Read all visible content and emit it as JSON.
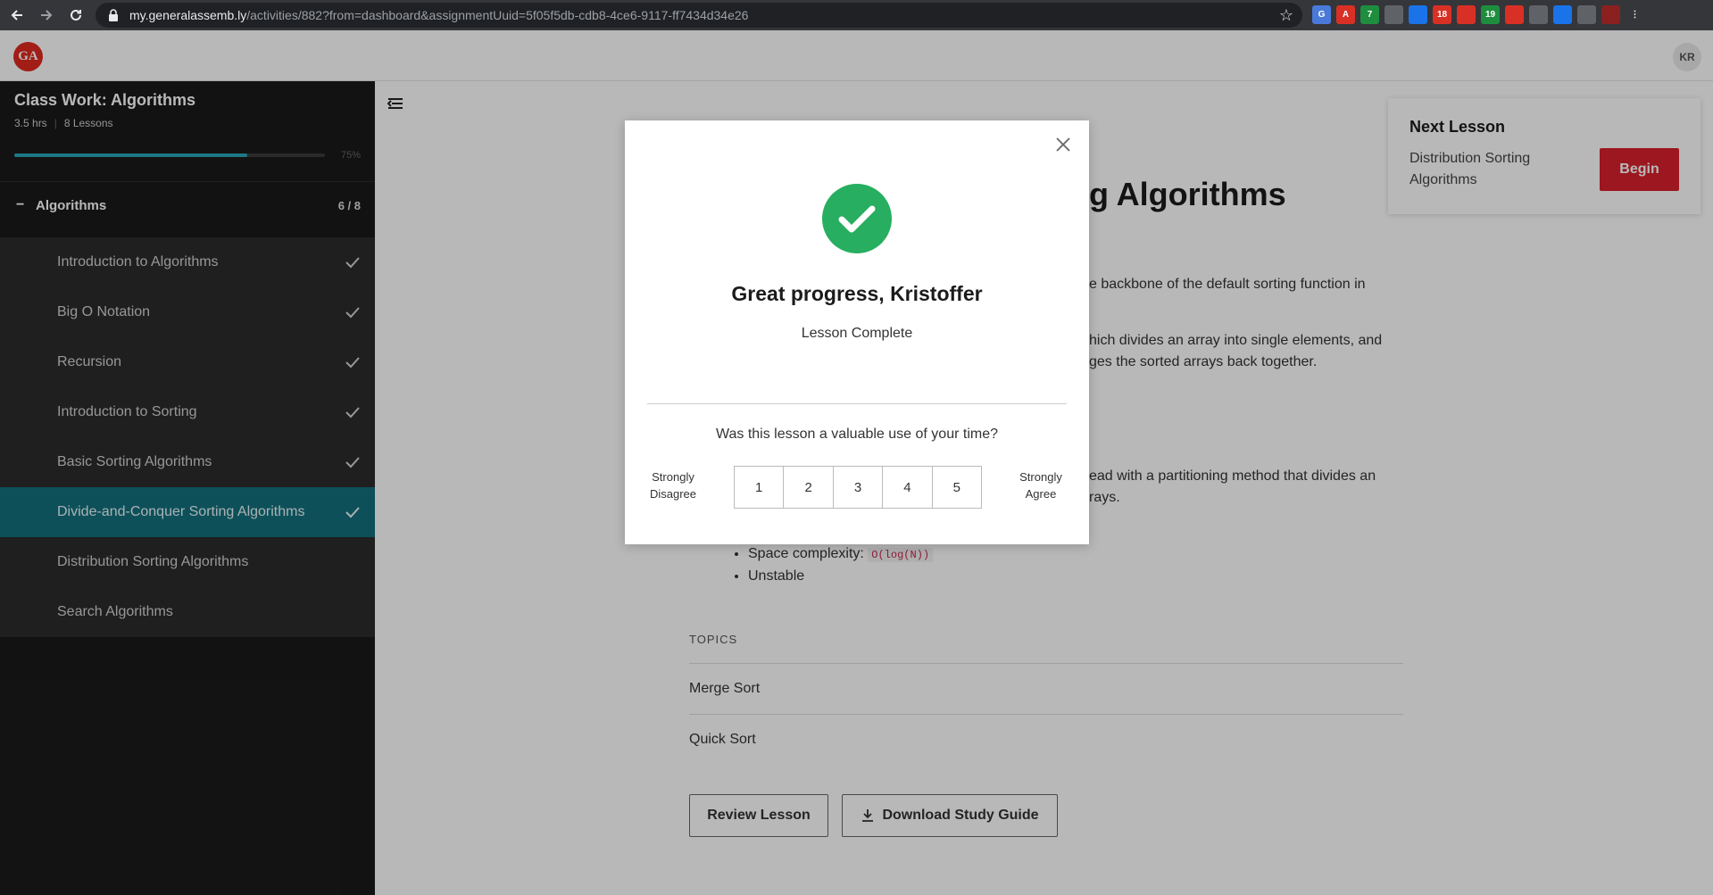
{
  "browser": {
    "url_host": "my.generalassemb.ly",
    "url_path": "/activities/882?from=dashboard&assignmentUuid=5f05f5db-cdb8-4ce6-9117-ff7434d34e26",
    "extensions": [
      {
        "name": "google-translate-icon",
        "color": "#4a7ad9",
        "text": "G"
      },
      {
        "name": "pdf-icon",
        "color": "#d93025",
        "text": "A"
      },
      {
        "name": "phone-extension-icon",
        "color": "#1e8e3e",
        "text": "7"
      },
      {
        "name": "pen-tool-icon",
        "color": "#5f6368",
        "text": ""
      },
      {
        "name": "send-extension-icon",
        "color": "#1a73e8",
        "text": ""
      },
      {
        "name": "adblock-icon",
        "color": "#d93025",
        "text": "18"
      },
      {
        "name": "stop-extension-icon",
        "color": "#d93025",
        "text": ""
      },
      {
        "name": "chat-extension-icon",
        "color": "#1e8e3e",
        "text": "19"
      },
      {
        "name": "lastpass-icon",
        "color": "#d93025",
        "text": ""
      },
      {
        "name": "layers-extension-icon",
        "color": "#5f6368",
        "text": ""
      },
      {
        "name": "react-devtools-icon",
        "color": "#1a73e8",
        "text": ""
      },
      {
        "name": "puzzle-icon",
        "color": "#5f6368",
        "text": ""
      },
      {
        "name": "profile-avatar-icon",
        "color": "#8a2020",
        "text": ""
      },
      {
        "name": "kebab-menu-icon",
        "color": "#35363a",
        "text": "⋮"
      }
    ]
  },
  "header": {
    "logo_text": "GA",
    "avatar_initials": "KR"
  },
  "sidebar": {
    "course_title": "Class Work: Algorithms",
    "duration": "3.5 hrs",
    "lessons_count": "8 Lessons",
    "progress_percent": 75,
    "progress_label": "75%",
    "section": {
      "toggle": "−",
      "name": "Algorithms",
      "count": "6 / 8"
    },
    "lessons": [
      {
        "label": "Introduction to Algorithms",
        "done": true,
        "active": false
      },
      {
        "label": "Big O Notation",
        "done": true,
        "active": false
      },
      {
        "label": "Recursion",
        "done": true,
        "active": false
      },
      {
        "label": "Introduction to Sorting",
        "done": true,
        "active": false
      },
      {
        "label": "Basic Sorting Algorithms",
        "done": true,
        "active": false
      },
      {
        "label": "Divide-and-Conquer Sorting Algorithms",
        "done": true,
        "active": true
      },
      {
        "label": "Distribution Sorting Algorithms",
        "done": false,
        "active": false
      },
      {
        "label": "Search Algorithms",
        "done": false,
        "active": false
      }
    ]
  },
  "main": {
    "title_visible": "g Algorithms",
    "para1": "e backbone of the default sorting function in",
    "para2_line1": "hich divides an array into single elements, and",
    "para2_line2": "ges the sorted arrays back together.",
    "para3_line1": "ead with a partitioning method that divides an",
    "para3_line2": "rays.",
    "bullet_space_label": "Space complexity:",
    "bullet_space_code": "O(log(N))",
    "bullet_unstable": "Unstable",
    "topics_label": "TOPICS",
    "topics": [
      "Merge Sort",
      "Quick Sort"
    ],
    "review_button": "Review Lesson",
    "download_button": "Download Study Guide"
  },
  "next_lesson": {
    "heading": "Next Lesson",
    "name": "Distribution Sorting Algorithms",
    "begin_button": "Begin"
  },
  "modal": {
    "title": "Great progress, Kristoffer",
    "subtitle": "Lesson Complete",
    "question": "Was this lesson a valuable use of your time?",
    "left_label": "Strongly Disagree",
    "right_label": "Strongly Agree",
    "options": [
      "1",
      "2",
      "3",
      "4",
      "5"
    ],
    "success_color": "#27ae60"
  }
}
